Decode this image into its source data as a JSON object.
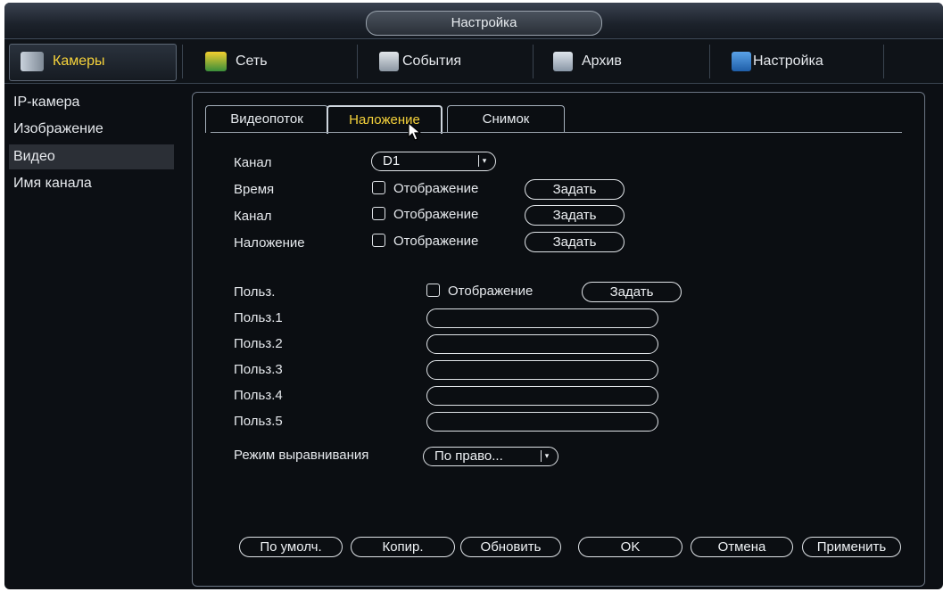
{
  "window": {
    "title": "Настройка"
  },
  "menu": {
    "items": [
      {
        "label": "Камеры",
        "icon": "camera-icon"
      },
      {
        "label": "Сеть",
        "icon": "network-icon"
      },
      {
        "label": "События",
        "icon": "events-icon"
      },
      {
        "label": "Архив",
        "icon": "archive-icon"
      },
      {
        "label": "Настройка",
        "icon": "settings-icon"
      }
    ]
  },
  "sidebar": {
    "items": [
      {
        "label": "IP-камера"
      },
      {
        "label": "Изображение"
      },
      {
        "label": "Видео"
      },
      {
        "label": "Имя канала"
      }
    ],
    "active": "Видео"
  },
  "tabs": [
    {
      "label": "Видеопоток"
    },
    {
      "label": "Наложение"
    },
    {
      "label": "Снимок"
    }
  ],
  "form": {
    "channel_label": "Канал",
    "channel_value": "D1",
    "rows": [
      {
        "label": "Время",
        "checkbox_label": "Отображение",
        "button": "Задать",
        "checked": false
      },
      {
        "label": "Канал",
        "checkbox_label": "Отображение",
        "button": "Задать",
        "checked": false
      },
      {
        "label": "Наложение",
        "checkbox_label": "Отображение",
        "button": "Задать",
        "checked": false
      }
    ],
    "user": {
      "label": "Польз.",
      "checkbox_label": "Отображение",
      "button": "Задать",
      "checked": false
    },
    "user_fields": [
      {
        "label": "Польз.1",
        "value": ""
      },
      {
        "label": "Польз.2",
        "value": ""
      },
      {
        "label": "Польз.3",
        "value": ""
      },
      {
        "label": "Польз.4",
        "value": ""
      },
      {
        "label": "Польз.5",
        "value": ""
      }
    ],
    "align_label": "Режим выравнивания",
    "align_value": "По право..."
  },
  "buttons": {
    "default": "По умолч.",
    "copy": "Копир.",
    "refresh": "Обновить",
    "ok": "OK",
    "cancel": "Отмена",
    "apply": "Применить"
  },
  "colors": {
    "active_tab_text": "#f5d23b",
    "background": "#0b0e12",
    "sidebar_active": "#2b2f36"
  }
}
